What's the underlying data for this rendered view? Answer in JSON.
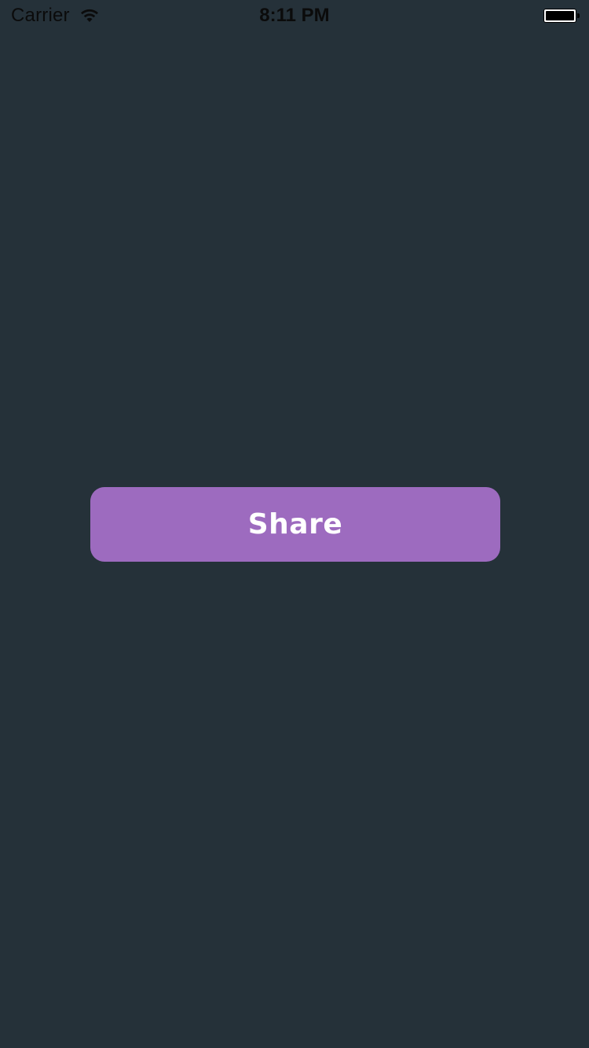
{
  "status_bar": {
    "carrier": "Carrier",
    "time": "8:11 PM",
    "wifi_icon": "wifi-icon",
    "battery_icon": "battery-icon"
  },
  "main": {
    "share_button_label": "Share"
  },
  "colors": {
    "background": "#253139",
    "button": "#9d6bbf",
    "button_text": "#ffffff"
  }
}
